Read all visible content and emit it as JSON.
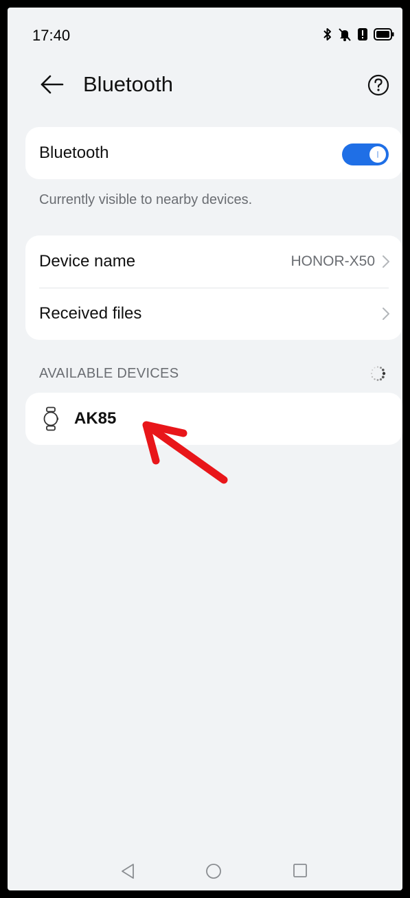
{
  "status_bar": {
    "time": "17:40",
    "icons": [
      "bluetooth-icon",
      "mute-icon",
      "alert-icon",
      "battery-icon"
    ]
  },
  "header": {
    "title": "Bluetooth",
    "back_icon": "back-arrow-icon",
    "help_icon": "help-icon"
  },
  "bluetooth": {
    "label": "Bluetooth",
    "enabled": true,
    "toggle_color": "#1f6fe6",
    "visibility_note": "Currently visible to nearby devices."
  },
  "settings": {
    "device_name_label": "Device name",
    "device_name_value": "HONOR-X50",
    "received_files_label": "Received files"
  },
  "available_devices": {
    "header": "AVAILABLE DEVICES",
    "items": [
      {
        "name": "AK85",
        "icon": "watch-icon"
      }
    ]
  },
  "annotation": {
    "arrow_color": "#e8161a",
    "target": "AK85"
  },
  "nav": {
    "icons": [
      "nav-back-icon",
      "nav-home-icon",
      "nav-recent-icon"
    ]
  }
}
